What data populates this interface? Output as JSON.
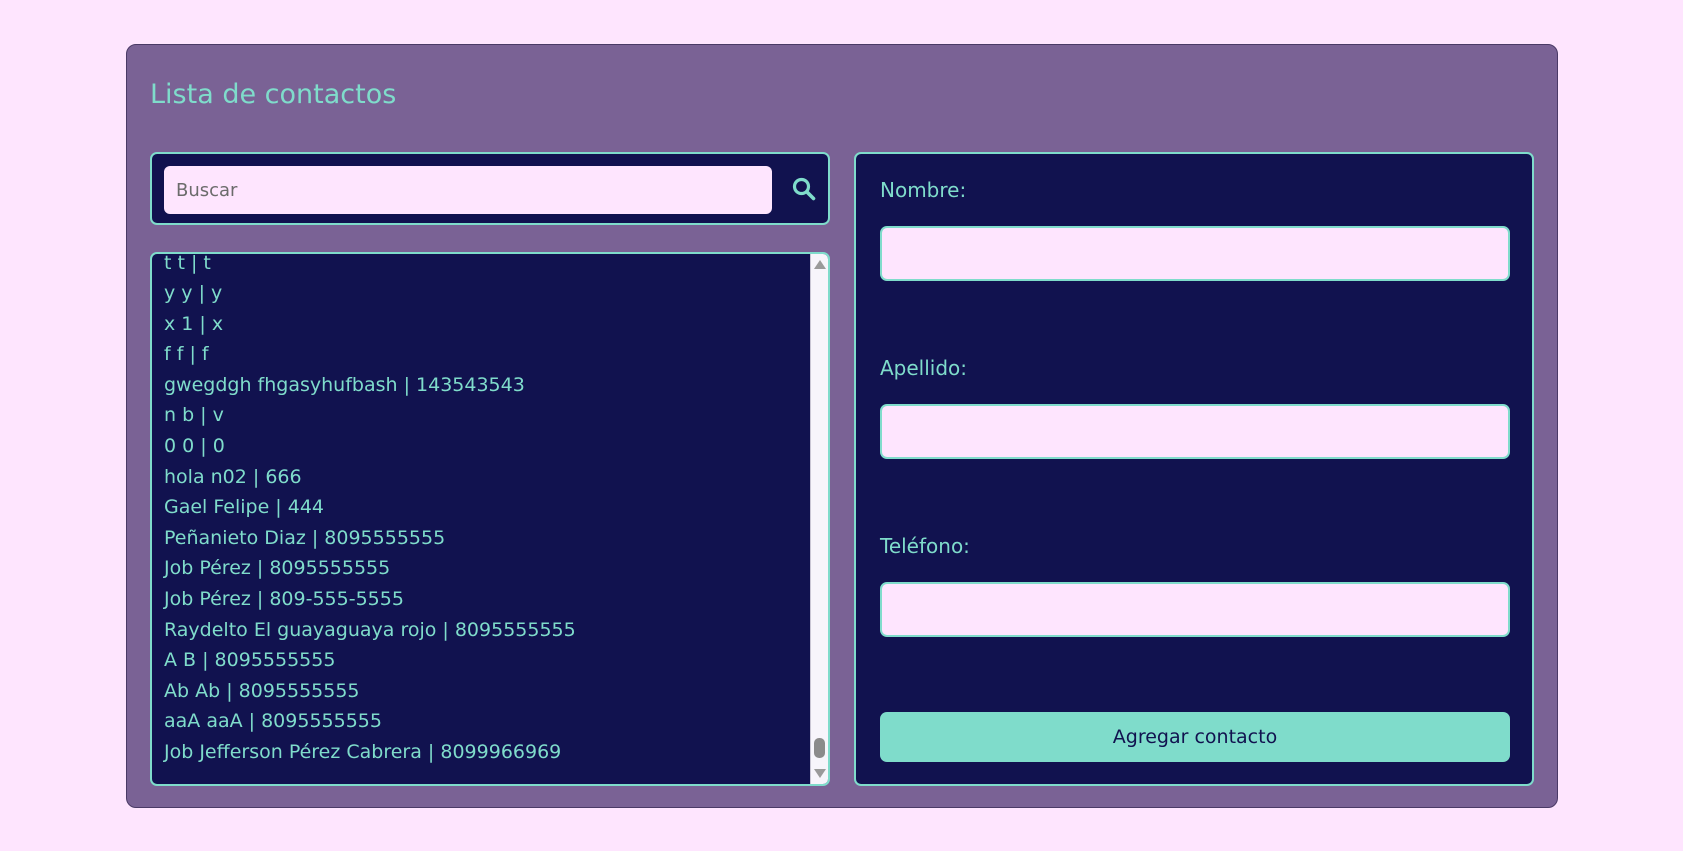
{
  "title": "Lista de contactos",
  "search": {
    "placeholder": "Buscar",
    "value": "",
    "icon": "search-icon"
  },
  "contacts": [
    "t t | t",
    "y y | y",
    "x 1 | x",
    "f f | f",
    "gwegdgh fhgasyhufbash | 143543543",
    "n b | v",
    "0 0 | 0",
    "hola n02 | 666",
    "Gael Felipe | 444",
    "Peñanieto Diaz | 8095555555",
    "Job Pérez | 8095555555",
    "Job Pérez | 809-555-5555",
    "Raydelto El guayaguaya rojo | 8095555555",
    "A B | 8095555555",
    "Ab Ab | 8095555555",
    "aaA aaA | 8095555555",
    "Job Jefferson Pérez Cabrera | 8099966969"
  ],
  "form": {
    "name_label": "Nombre:",
    "name_value": "",
    "lastname_label": "Apellido:",
    "lastname_value": "",
    "phone_label": "Teléfono:",
    "phone_value": "",
    "submit_label": "Agregar contacto"
  },
  "colors": {
    "page_background": "#fee5fe",
    "card_background": "#7a6295",
    "panel_background": "#11124f",
    "accent": "#7fdccb"
  }
}
